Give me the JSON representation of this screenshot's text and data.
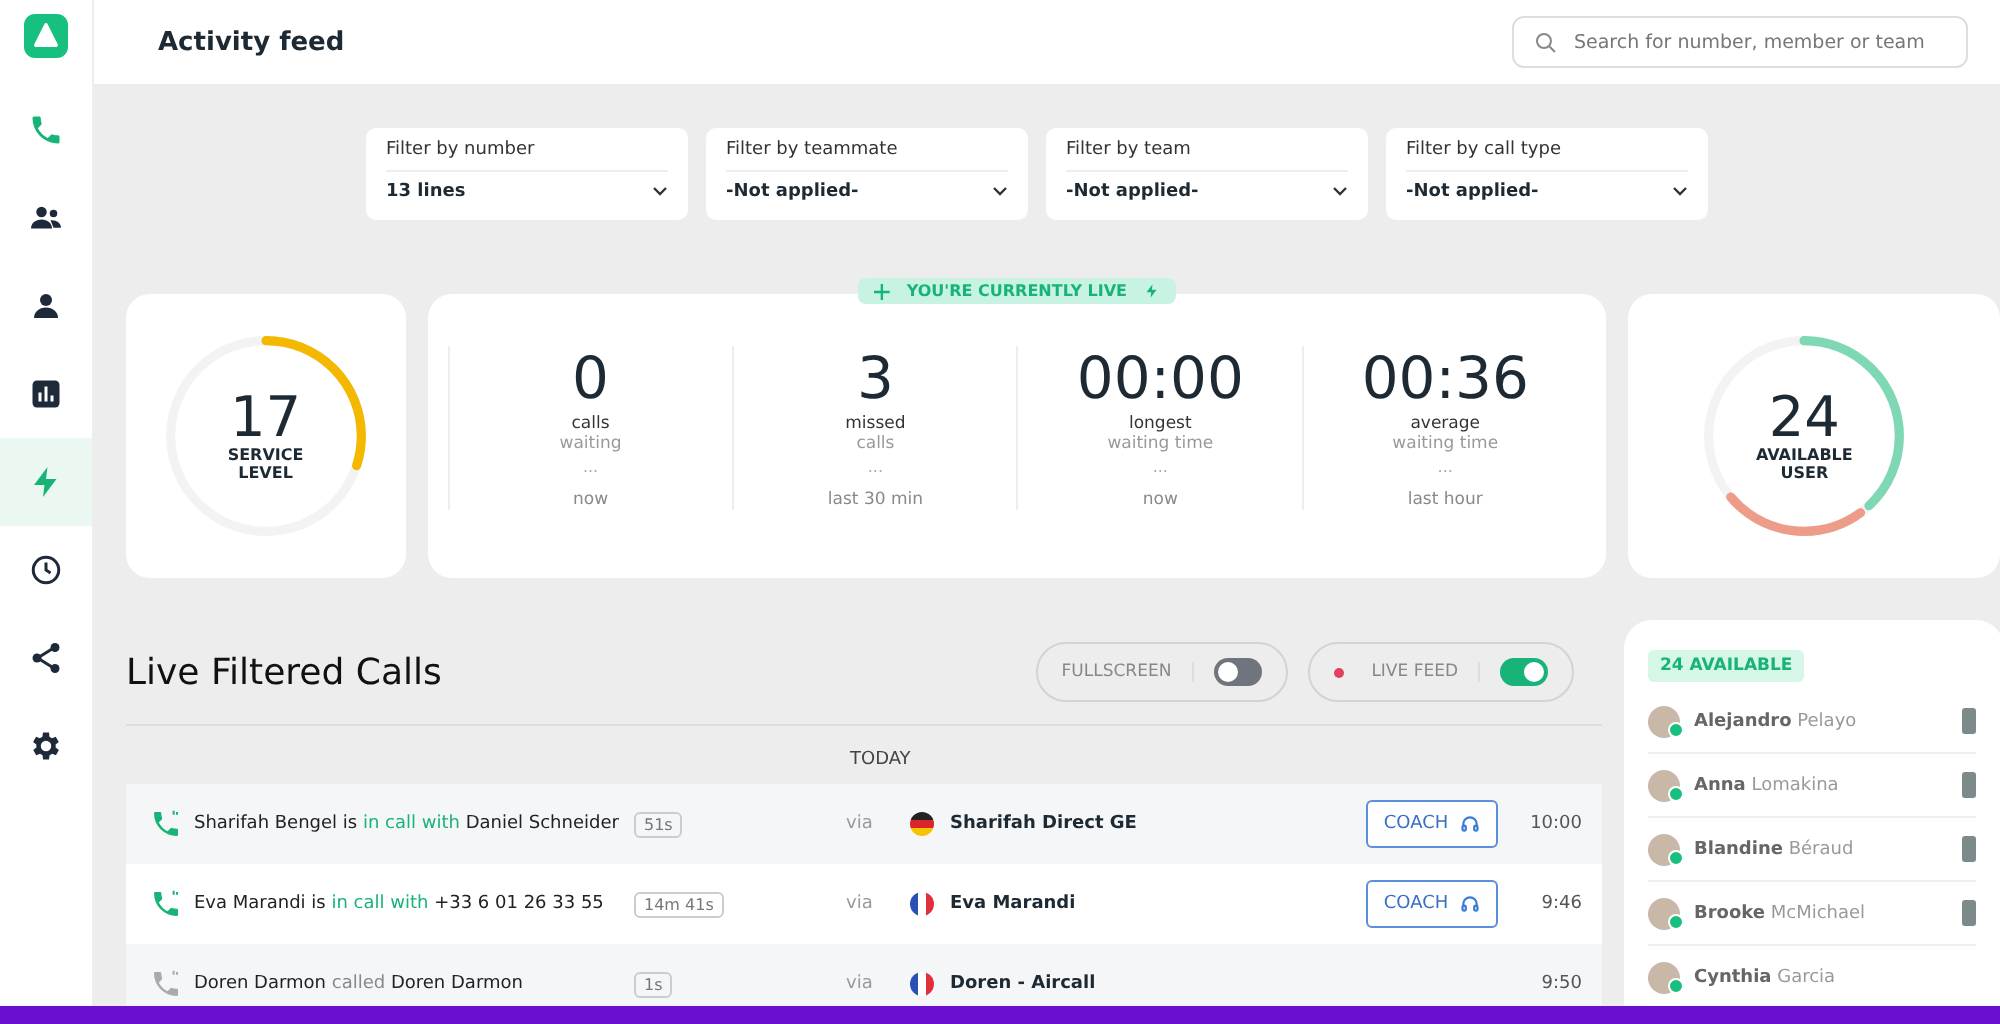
{
  "header": {
    "title": "Activity feed",
    "search": {
      "placeholder": "Search for number, member or team"
    }
  },
  "sidebar": {
    "items": [
      {
        "kind": "phone",
        "selected": false
      },
      {
        "kind": "team",
        "selected": false
      },
      {
        "kind": "person",
        "selected": false
      },
      {
        "kind": "chart",
        "selected": false
      },
      {
        "kind": "bolt",
        "selected": true
      },
      {
        "kind": "clock",
        "selected": false
      },
      {
        "kind": "share",
        "selected": false
      },
      {
        "kind": "gear",
        "selected": false
      }
    ]
  },
  "filters": [
    {
      "label": "Filter by number",
      "value": "13 lines"
    },
    {
      "label": "Filter by teammate",
      "value": "-Not applied-"
    },
    {
      "label": "Filter by team",
      "value": "-Not applied-"
    },
    {
      "label": "Filter by call type",
      "value": "-Not applied-"
    }
  ],
  "service_level": {
    "value": "17",
    "label": "SERVICE LEVEL",
    "level": 0.3
  },
  "live_badge": "YOU'RE CURRENTLY LIVE",
  "stats": [
    {
      "value": "0",
      "label": "calls",
      "sub": "waiting",
      "dots": "...",
      "period": "now"
    },
    {
      "value": "3",
      "label": "missed",
      "sub": "calls",
      "dots": "...",
      "period": "last 30 min"
    },
    {
      "value": "00:00",
      "label": "longest",
      "sub": "waiting time",
      "dots": "...",
      "period": "now"
    },
    {
      "value": "00:36",
      "label": "average",
      "sub": "waiting time",
      "dots": "...",
      "period": "last hour"
    }
  ],
  "available_users": {
    "value": "24",
    "label": "AVAILABLE USER",
    "segments": [
      {
        "color": "#7fd8b4",
        "level": 0.38
      },
      {
        "color": "#ec9c88",
        "level": 0.24
      }
    ]
  },
  "live_calls": {
    "title": "Live Filtered Calls",
    "toggles": [
      {
        "label": "FULLSCREEN",
        "on": false,
        "dot": false
      },
      {
        "label": "LIVE FEED",
        "on": true,
        "dot": true
      }
    ],
    "day": "TODAY",
    "rows": [
      {
        "active": true,
        "caller": "Sharifah Bengel",
        "verb": "is",
        "action": "in call with",
        "callee": "Daniel Schneider",
        "duration": "51s",
        "via": "via",
        "kind": "de",
        "line": "Sharifah Direct GE",
        "coach": "COACH",
        "time": "10:00"
      },
      {
        "active": true,
        "caller": "Eva Marandi",
        "verb": "is",
        "action": "in call with",
        "callee": "+33 6 01 26 33 55",
        "duration": "14m 41s",
        "via": "via",
        "kind": "fr",
        "line": "Eva Marandi",
        "coach": "COACH",
        "time": "9:46"
      },
      {
        "active": false,
        "caller": "Doren Darmon",
        "verb": "",
        "action": "called",
        "callee": "Doren Darmon",
        "duration": "1s",
        "via": "via",
        "kind": "fr",
        "line": "Doren - Aircall",
        "time": "9:50"
      }
    ]
  },
  "team_panel": {
    "badge": "24 AVAILABLE",
    "agents": [
      {
        "first": "Alejandro",
        "last": "Pelayo",
        "phone": true
      },
      {
        "first": "Anna",
        "last": "Lomakina",
        "phone": true
      },
      {
        "first": "Blandine",
        "last": "Béraud",
        "phone": true
      },
      {
        "first": "Brooke",
        "last": "McMichael",
        "phone": true
      },
      {
        "first": "Cynthia",
        "last": "Garcia",
        "phone": false
      }
    ]
  }
}
